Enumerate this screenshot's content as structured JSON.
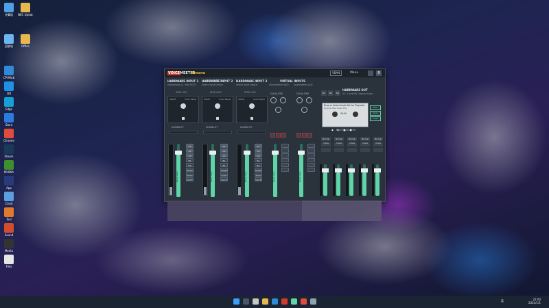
{
  "desktop_icons": [
    {
      "label": "计算机",
      "color": "#4ea1e6"
    },
    {
      "label": "NEC Update",
      "color": "#e6b84e"
    },
    {
      "label": "回收站",
      "color": "#6cb6f0"
    },
    {
      "label": "Office",
      "color": "#e6b84e"
    },
    {
      "label": "CPUHub",
      "color": "#2f8ad9"
    },
    {
      "label": "QQ",
      "color": "#1e90e6"
    },
    {
      "label": "Edge",
      "color": "#16a0d8"
    },
    {
      "label": "Store",
      "color": "#2d7be0"
    },
    {
      "label": "Chrome",
      "color": "#e14b3b"
    },
    {
      "label": "Steam",
      "color": "#1b3a5a"
    },
    {
      "label": "NVIDIA",
      "color": "#3f8f2f"
    },
    {
      "label": "App",
      "color": "#283a78"
    },
    {
      "label": "Clash",
      "color": "#5a9fe0"
    },
    {
      "label": "Tool",
      "color": "#e07a2d"
    },
    {
      "label": "Sound",
      "color": "#d14d2f"
    },
    {
      "label": "Media",
      "color": "#333333"
    },
    {
      "label": "Files",
      "color": "#e6e6e6"
    }
  ],
  "window": {
    "brand_voice": "VOICE",
    "brand_meeter": "MEETER",
    "brand_banana": "Banana",
    "vban": "VBAN",
    "menu": "Menu",
    "close": "X"
  },
  "strips": [
    {
      "name": "HARDWARE INPUT 1",
      "device": "Microphone (1- Intel HD T)",
      "label": "INTELLIGO",
      "audibility": "AUDIBILITY",
      "routes": [
        "A1",
        "A2",
        "A3",
        "B1",
        "B2",
        "MONO",
        "SOLO",
        "MUTE"
      ],
      "gain": "Fader Gain"
    },
    {
      "name": "HARDWARE INPUT 2",
      "device": "Select Input Device",
      "label": "INTELLIGO",
      "audibility": "AUDIBILITY",
      "routes": [
        "A1",
        "A2",
        "A3",
        "B1",
        "B2",
        "MONO",
        "SOLO",
        "MUTE"
      ],
      "gain": "Fader Gain"
    },
    {
      "name": "HARDWARE INPUT 3",
      "device": "Select Input Device",
      "label": "INTELLIGO",
      "audibility": "AUDIBILITY",
      "routes": [
        "A1",
        "A2",
        "A3",
        "B1",
        "B2",
        "MONO",
        "SOLO",
        "MUTE"
      ],
      "gain": "Fader Gain"
    }
  ],
  "virtual": {
    "title": "VIRTUAL INPUTS",
    "v1": "Voicemeeter VAIO",
    "v2": "Voicemeeter AUX",
    "eq": "EQUALIZER",
    "gain": "Fader Gain"
  },
  "hw_out": {
    "title": "HARDWARE OUT",
    "device": "A1: 1-Intel(R) Display Audio",
    "a_buttons": [
      "A1",
      "A2",
      "A3"
    ],
    "cassette_line1": "Drop or Select Audio file for Playback",
    "cassette_line2": "Drop & Play Audio File",
    "cassette_time": "00:00",
    "side_buttons": [
      "REC",
      "PLAY",
      "LOOP"
    ],
    "master": "MASTER SECTION",
    "buses": [
      "Normal mode",
      "Normal mode",
      "Normal mode",
      "Normal mode",
      "Normal mode"
    ]
  },
  "taskbar": {
    "tray_text": "英",
    "time": "22:00",
    "date": "2024/1/1"
  }
}
